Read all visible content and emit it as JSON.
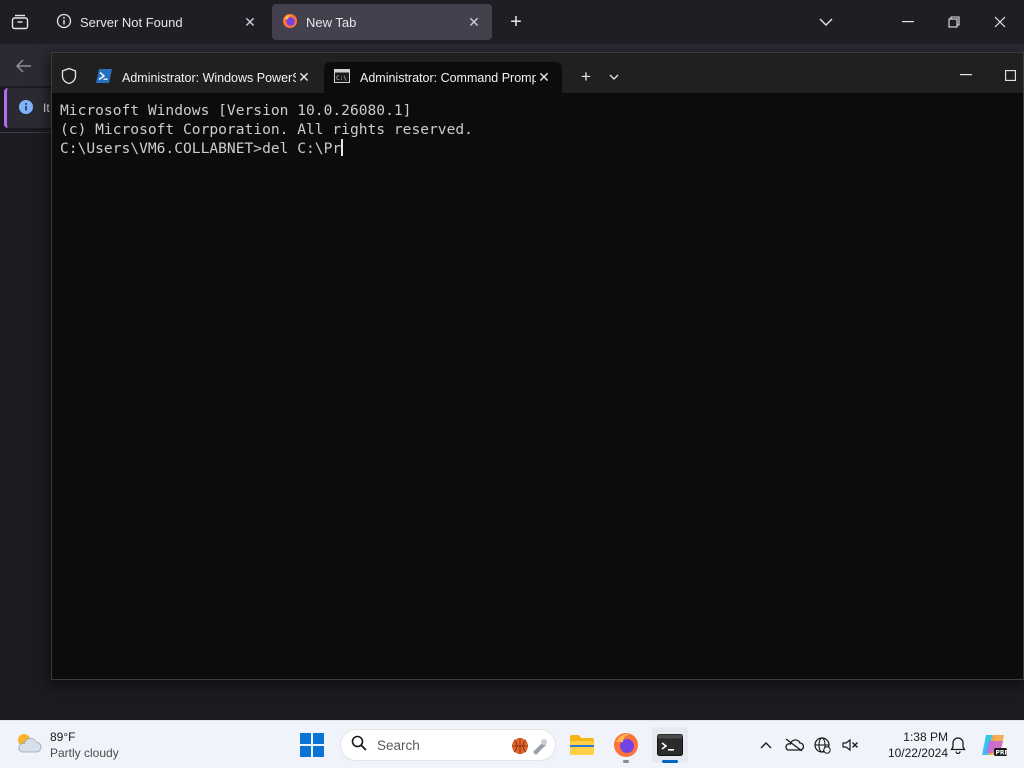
{
  "firefox": {
    "tabs": [
      {
        "label": "Server Not Found"
      },
      {
        "label": "New Tab"
      }
    ],
    "notification_text": "It"
  },
  "terminal": {
    "tabs": [
      {
        "label": "Administrator: Windows PowerShell"
      },
      {
        "label": "Administrator: Command Prompt"
      }
    ],
    "lines": [
      "Microsoft Windows [Version 10.0.26080.1]",
      "(c) Microsoft Corporation. All rights reserved.",
      "",
      "C:\\Users\\VM6.COLLABNET>del C:\\Pr"
    ]
  },
  "taskbar": {
    "weather": {
      "temp": "89°F",
      "condition": "Partly cloudy"
    },
    "search_label": "Search",
    "clock": {
      "time": "1:38 PM",
      "date": "10/22/2024"
    }
  },
  "colors": {
    "terminal_bg": "#0c0c0c",
    "terminal_text": "#cccccc",
    "firefox_bg": "#1c1b22",
    "taskbar_bg": "#f0f3f9",
    "accent": "#0067c0"
  }
}
